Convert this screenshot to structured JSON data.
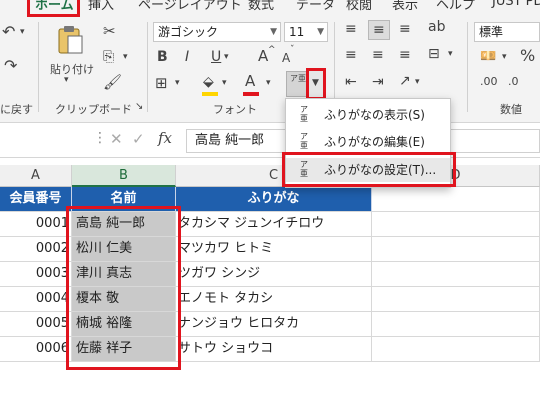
{
  "ribbon": {
    "tabs": [
      {
        "label": "ホーム",
        "selected": true
      },
      {
        "label": "挿入"
      },
      {
        "label": "ページレイアウト"
      },
      {
        "label": "数式"
      },
      {
        "label": "データ"
      },
      {
        "label": "校閲"
      },
      {
        "label": "表示"
      },
      {
        "label": "ヘルプ"
      },
      {
        "label": "JUST PD"
      }
    ],
    "clipboard": {
      "undo_label": "に戻す",
      "paste_label": "貼り付け",
      "group_label": "クリップボード",
      "launcher": "↘"
    },
    "font": {
      "font_name": "游ゴシック",
      "font_size": "11",
      "grow_label": "A",
      "shrink_label": "A",
      "bold": "B",
      "italic": "I",
      "underline": "U",
      "font_color_label": "A",
      "phonetic_label": "ア亜",
      "group_label": "フォント",
      "launcher": "↘",
      "font_color": "#e0141e",
      "fill_color": "#ffd500"
    },
    "number": {
      "format": "標準",
      "percent": "%",
      "group_label": "数値"
    }
  },
  "formula_bar": {
    "fx": "fx",
    "value": "高島 純一郎"
  },
  "columns": [
    "A",
    "B",
    "C",
    "D"
  ],
  "table": {
    "headers": [
      "会員番号",
      "名前",
      "ふりがな"
    ],
    "rows": [
      {
        "id": "0001",
        "name": "高島 純一郎",
        "kana": "タカシマ ジュンイチロウ"
      },
      {
        "id": "0002",
        "name": "松川 仁美",
        "kana": "マツカワ ヒトミ"
      },
      {
        "id": "0003",
        "name": "津川 真志",
        "kana": "ツガワ シンジ"
      },
      {
        "id": "0004",
        "name": "榎本 敬",
        "kana": "エノモト タカシ"
      },
      {
        "id": "0005",
        "name": "楠城 裕隆",
        "kana": "ナンジョウ ヒロタカ"
      },
      {
        "id": "0006",
        "name": "佐藤 祥子",
        "kana": "サトウ ショウコ"
      }
    ]
  },
  "phonetic_menu": {
    "items": [
      {
        "label": "ふりがなの表示(S)"
      },
      {
        "label": "ふりがなの編集(E)"
      },
      {
        "label": "ふりがなの設定(T)..."
      }
    ]
  },
  "colors": {
    "header_bg": "#1f5fad",
    "highlight": "#e0141e",
    "accent_green": "#217346"
  }
}
